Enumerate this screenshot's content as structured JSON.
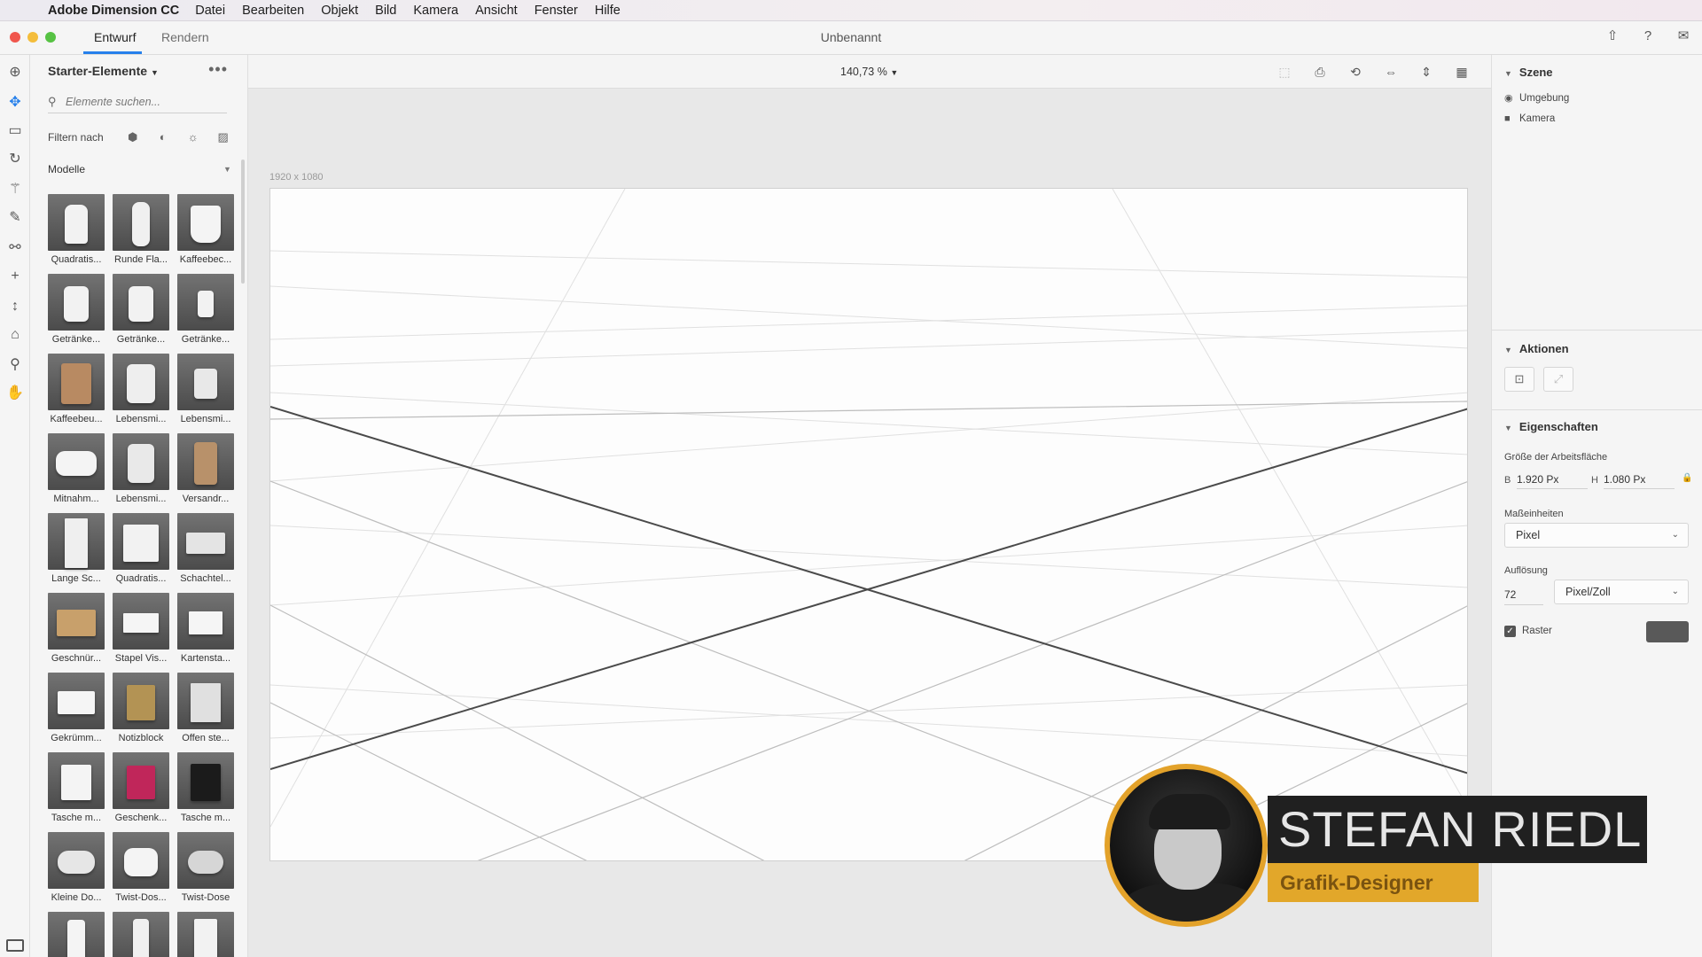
{
  "menubar": {
    "apple_icon": "apple-icon",
    "app_name": "Adobe Dimension CC",
    "items": [
      "Datei",
      "Bearbeiten",
      "Objekt",
      "Bild",
      "Kamera",
      "Ansicht",
      "Fenster",
      "Hilfe"
    ]
  },
  "titlebar": {
    "tabs": [
      "Entwurf",
      "Rendern"
    ],
    "active_tab": "Entwurf",
    "document_title": "Unbenannt",
    "right_icons": [
      "share-icon",
      "help-icon",
      "feedback-icon"
    ]
  },
  "tools": [
    "add-icon",
    "select-icon",
    "artboard-icon",
    "orbit-icon",
    "magic-wand-icon",
    "eyedropper-icon",
    "lasso-icon",
    "pan-plus-icon",
    "dolly-icon",
    "horizon-icon",
    "zoom-icon",
    "hand-icon"
  ],
  "assets": {
    "header": "Starter-Elemente",
    "search_placeholder": "Elemente suchen...",
    "filter_label": "Filtern nach",
    "filter_icons": [
      "model-filter-icon",
      "material-filter-icon",
      "light-filter-icon",
      "image-filter-icon"
    ],
    "section": "Modelle",
    "items": [
      "Quadratis...",
      "Runde Fla...",
      "Kaffeebec...",
      "Getränke...",
      "Getränke...",
      "Getränke...",
      "Kaffeebeu...",
      "Lebensmi...",
      "Lebensmi...",
      "Mitnahm...",
      "Lebensmi...",
      "Versandr...",
      "Lange Sc...",
      "Quadratis...",
      "Schachtel...",
      "Geschnür...",
      "Stapel Vis...",
      "Kartensta...",
      "Gekrümm...",
      "Notizblock",
      "Offen ste...",
      "Tasche m...",
      "Geschenk...",
      "Tasche m...",
      "Kleine Do...",
      "Twist-Dos...",
      "Twist-Dose",
      "",
      "",
      ""
    ]
  },
  "canvas": {
    "zoom": "140,73 %",
    "artboard_size": "1920 x 1080",
    "camera_icons": [
      "frame-icon",
      "camera-bookmark-icon",
      "camera-orbit-icon",
      "camera-pan-icon",
      "camera-dolly-icon",
      "render-preview-icon"
    ]
  },
  "props": {
    "scene_title": "Szene",
    "scene_items": [
      "Umgebung",
      "Kamera"
    ],
    "actions_title": "Aktionen",
    "properties_title": "Eigenschaften",
    "artboard_size_label": "Größe der Arbeitsfläche",
    "width_key": "B",
    "width_value": "1.920 Px",
    "height_key": "H",
    "height_value": "1.080 Px",
    "units_label": "Maßeinheiten",
    "units_value": "Pixel",
    "resolution_label": "Auflösung",
    "resolution_value": "72",
    "resolution_unit": "Pixel/Zoll",
    "grid_label": "Raster",
    "grid_checked": true,
    "grid_color": "#595959"
  },
  "overlay": {
    "name": "STEFAN RIEDL",
    "role": "Grafik-Designer"
  },
  "colors": {
    "accent": "#2680eb",
    "badge_gold": "#e3a22a"
  }
}
